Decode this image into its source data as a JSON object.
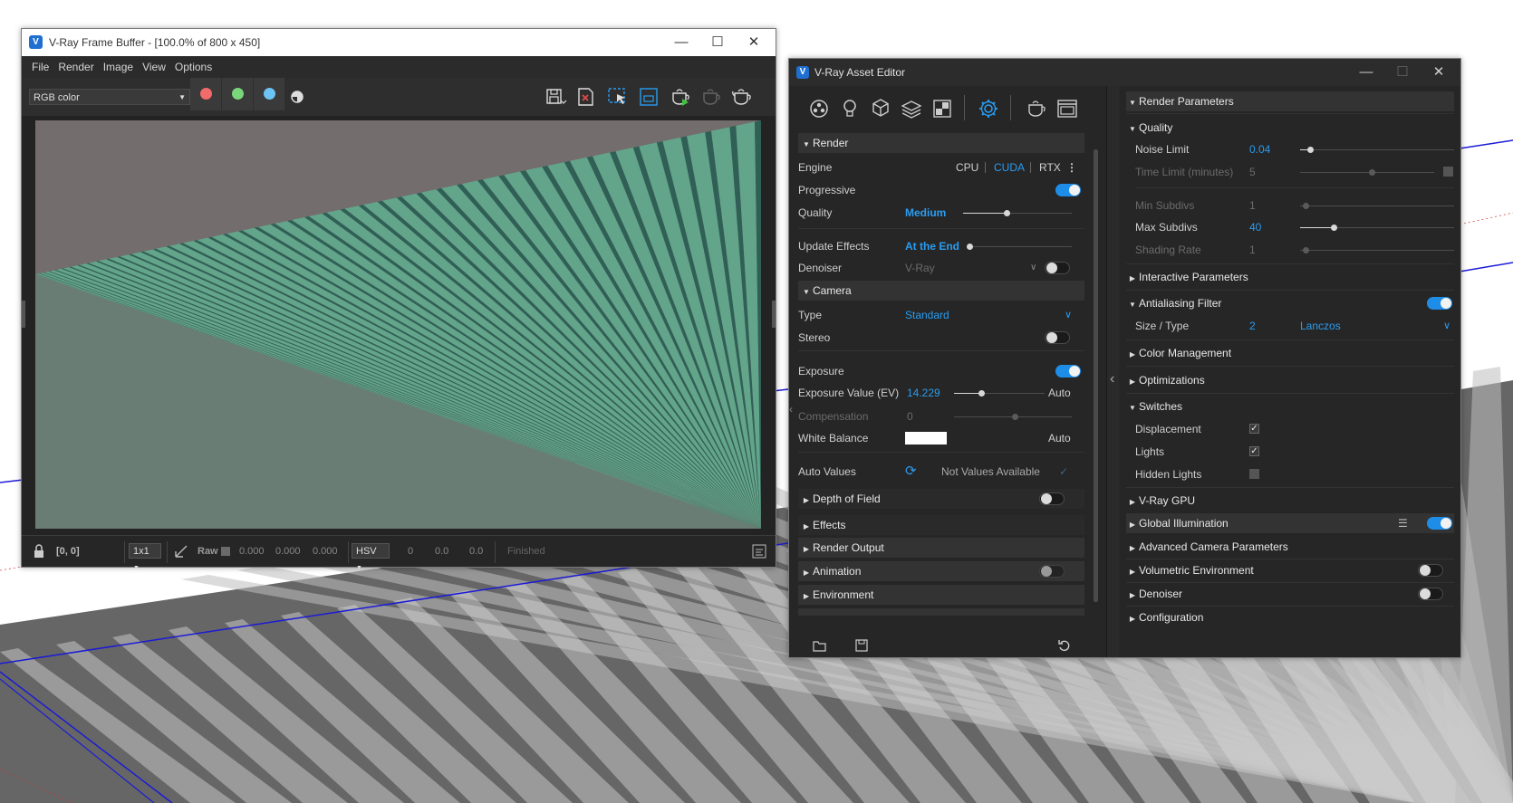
{
  "vfb": {
    "title": "V-Ray Frame Buffer - [100.0% of 800 x 450]",
    "menu": [
      "File",
      "Render",
      "Image",
      "View",
      "Options"
    ],
    "channel": "RGB color",
    "channel_colors": {
      "red": "#f26b6b",
      "green": "#7ad67a",
      "blue": "#6cc4f4"
    },
    "status": {
      "coords": "[0, 0]",
      "sample_size": "1x1",
      "raw_label": "Raw",
      "raw_values": [
        "0.000",
        "0.000",
        "0.000"
      ],
      "color_space": "HSV",
      "hsv_values": [
        "0",
        "0.0",
        "0.0"
      ],
      "state": "Finished"
    }
  },
  "asset_editor": {
    "title": "V-Ray Asset Editor",
    "render": {
      "section": "Render",
      "engine_label": "Engine",
      "engines": [
        "CPU",
        "CUDA",
        "RTX"
      ],
      "active_engine": "CUDA",
      "progressive_label": "Progressive",
      "progressive": true,
      "quality_label": "Quality",
      "quality_value": "Medium",
      "update_effects_label": "Update Effects",
      "update_effects_value": "At the End",
      "denoiser_label": "Denoiser",
      "denoiser_value": "V-Ray",
      "denoiser": false
    },
    "camera": {
      "section": "Camera",
      "type_label": "Type",
      "type_value": "Standard",
      "stereo_label": "Stereo",
      "stereo": false,
      "exposure_label": "Exposure",
      "exposure": true,
      "exposure_value_label": "Exposure Value (EV)",
      "exposure_value": "14.229",
      "exposure_auto": "Auto",
      "compensation_label": "Compensation",
      "compensation_value": "0",
      "white_balance_label": "White Balance",
      "white_balance_color": "#ffffff",
      "white_balance_auto": "Auto",
      "auto_values_label": "Auto Values",
      "auto_values_status": "Not Values Available"
    },
    "left_sections": [
      "Depth of Field",
      "Effects",
      "Render Output",
      "Animation",
      "Environment"
    ],
    "right": {
      "header": "Render Parameters",
      "quality": {
        "section": "Quality",
        "noise_limit_label": "Noise Limit",
        "noise_limit": "0.04",
        "time_limit_label": "Time Limit (minutes)",
        "time_limit": "5",
        "min_subdivs_label": "Min Subdivs",
        "min_subdivs": "1",
        "max_subdivs_label": "Max Subdivs",
        "max_subdivs": "40",
        "shading_rate_label": "Shading Rate",
        "shading_rate": "1"
      },
      "interactive": "Interactive Parameters",
      "antialiasing": {
        "section": "Antialiasing Filter",
        "size_type_label": "Size / Type",
        "size": "2",
        "type": "Lanczos"
      },
      "color_management": "Color Management",
      "optimizations": "Optimizations",
      "switches": {
        "section": "Switches",
        "displacement_label": "Displacement",
        "displacement": true,
        "lights_label": "Lights",
        "lights": true,
        "hidden_lights_label": "Hidden Lights",
        "hidden_lights": false
      },
      "gpu": "V-Ray GPU",
      "gi": "Global Illumination",
      "advanced_camera": "Advanced Camera Parameters",
      "volumetric": "Volumetric Environment",
      "denoiser": "Denoiser",
      "configuration": "Configuration"
    }
  }
}
